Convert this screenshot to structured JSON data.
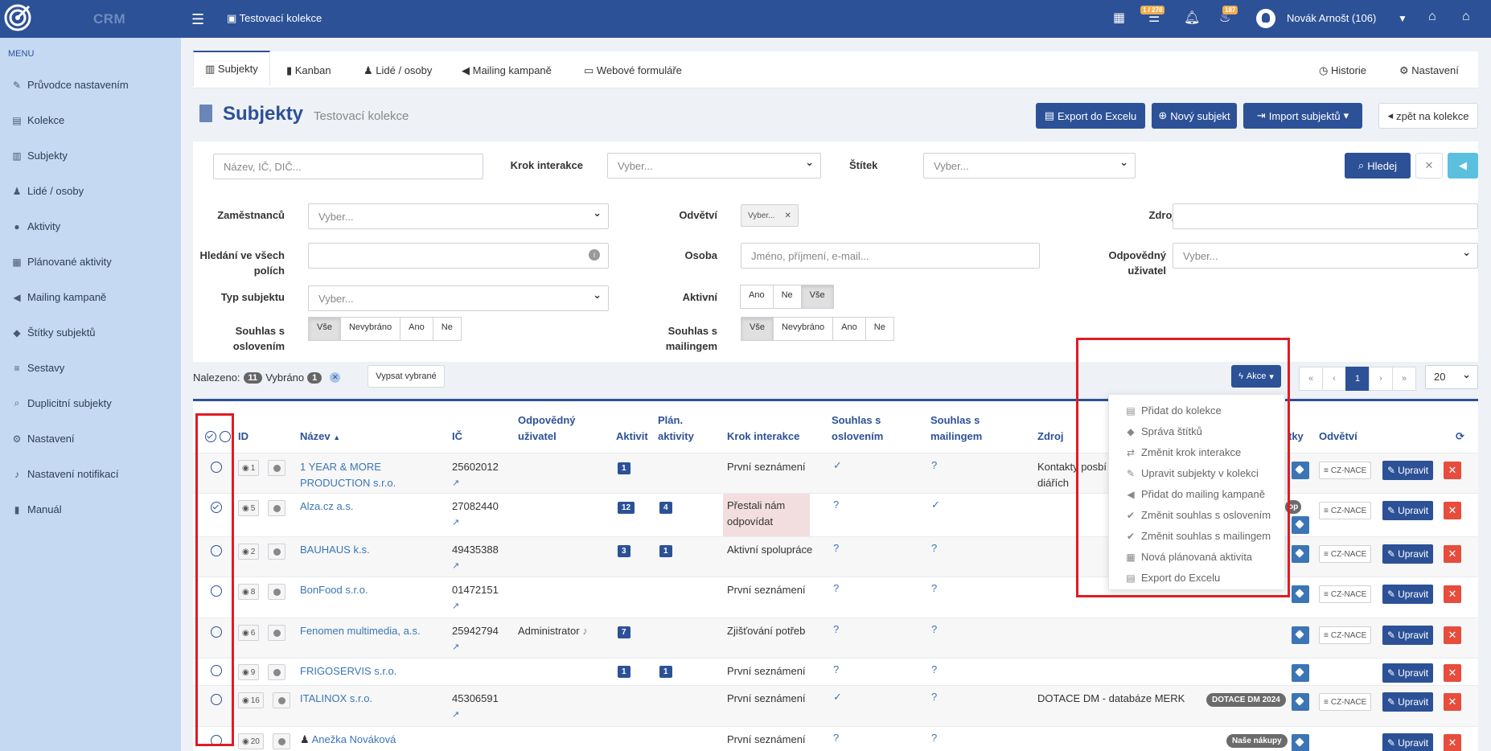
{
  "topbar": {
    "app_name": "CRM",
    "collection": "Testovací kolekce",
    "tasks_badge": "1 / 278",
    "notif_badge": "187",
    "user": "Novák Arnošt (106)"
  },
  "sidebar": {
    "menu_label": "MENU",
    "items": [
      {
        "label": "Průvodce nastavením",
        "icon": "wand-icon"
      },
      {
        "label": "Kolekce",
        "icon": "folders-icon"
      },
      {
        "label": "Subjekty",
        "icon": "building-icon"
      },
      {
        "label": "Lidé / osoby",
        "icon": "person-icon"
      },
      {
        "label": "Aktivity",
        "icon": "comments-icon"
      },
      {
        "label": "Plánované aktivity",
        "icon": "calendar-icon"
      },
      {
        "label": "Mailing kampaně",
        "icon": "megaphone-icon"
      },
      {
        "label": "Štítky subjektů",
        "icon": "tags-icon"
      },
      {
        "label": "Sestavy",
        "icon": "list-icon"
      },
      {
        "label": "Duplicitní subjekty",
        "icon": "search-doc-icon"
      },
      {
        "label": "Nastavení",
        "icon": "gears-icon"
      },
      {
        "label": "Nastavení notifikací",
        "icon": "bell-icon"
      },
      {
        "label": "Manuál",
        "icon": "book-icon"
      }
    ]
  },
  "tabs": {
    "subjekty": "Subjekty",
    "kanban": "Kanban",
    "lide": "Lidé / osoby",
    "mailing": "Mailing kampaně",
    "formulare": "Webové formuláře",
    "historie": "Historie",
    "nastaveni": "Nastavení"
  },
  "header": {
    "title": "Subjekty",
    "subtitle": "Testovací kolekce",
    "export": "Export do Excelu",
    "new": "Nový subjekt",
    "import": "Import subjektů",
    "back": "zpět na kolekce"
  },
  "filters": {
    "search_placeholder": "Název, IČ, DIČ...",
    "krok_label": "Krok interakce",
    "krok_value": "Vyber...",
    "stitek_label": "Štítek",
    "stitek_value": "Vyber...",
    "hledej": "Hledej",
    "zamestnancu_label": "Zaměstnanců",
    "zamestnancu_value": "Vyber...",
    "odvetvi_label": "Odvětví",
    "odvetvi_value": "Vyber...",
    "zdroj_label": "Zdroj",
    "hledani_label": "Hledání ve všech polích",
    "osoba_label": "Osoba",
    "osoba_placeholder": "Jméno, příjmení, e-mail...",
    "odpovedny_label": "Odpovědný uživatel",
    "odpovedny_value": "Vyber...",
    "typ_label": "Typ subjektu",
    "typ_value": "Vyber...",
    "aktivni_label": "Aktivní",
    "aktivni_options": [
      "Ano",
      "Ne",
      "Vše"
    ],
    "souhlas_osl_label": "Souhlas s oslovením",
    "souhlas_mail_label": "Souhlas s mailingem",
    "souhlas_options": [
      "Vše",
      "Nevybráno",
      "Ano",
      "Ne"
    ]
  },
  "results": {
    "nalezeno_label": "Nalezeno:",
    "nalezeno_count": "11",
    "vybrano_label": "Vybráno",
    "vybrano_count": "1",
    "vypsat": "Vypsat vybrané",
    "akce": "Akce",
    "pager": [
      "«",
      "‹",
      "1",
      "›",
      "»"
    ],
    "per_page": "20"
  },
  "table": {
    "headers": {
      "id": "ID",
      "nazev": "Název",
      "ic": "IČ",
      "odpovedny": "Odpovědný uživatel",
      "aktivit": "Aktivit",
      "plan": "Plán. aktivity",
      "krok": "Krok interakce",
      "souhlas_osl": "Souhlas s oslovením",
      "souhlas_mail": "Souhlas s mailingem",
      "zdroj": "Zdroj",
      "stitky": "tky",
      "odvetvi": "Odvětví"
    },
    "rows": [
      {
        "id": "1",
        "nazev": "1 YEAR & MORE PRODUCTION s.r.o.",
        "ic": "25602012",
        "odpovedny": "",
        "aktivit": "1",
        "plan": "",
        "krok": "První seznámení",
        "osl": "✓",
        "mail": "?",
        "zdroj": "Kontakty posbí diářích",
        "badge": "",
        "nace": "CZ-NACE"
      },
      {
        "id": "5",
        "nazev": "Alza.cz a.s.",
        "ic": "27082440",
        "odpovedny": "",
        "aktivit": "12",
        "plan": "4",
        "krok": "Přestali nám odpovídat",
        "osl": "?",
        "mail": "✓",
        "zdroj": "",
        "badge": "op",
        "nace": "CZ-NACE"
      },
      {
        "id": "2",
        "nazev": "BAUHAUS k.s.",
        "ic": "49435388",
        "odpovedny": "",
        "aktivit": "3",
        "plan": "1",
        "krok": "Aktivní spolupráce",
        "osl": "?",
        "mail": "?",
        "zdroj": "",
        "badge": "",
        "nace": "CZ-NACE"
      },
      {
        "id": "8",
        "nazev": "BonFood s.r.o.",
        "ic": "01472151",
        "odpovedny": "",
        "aktivit": "",
        "plan": "",
        "krok": "První seznámení",
        "osl": "?",
        "mail": "?",
        "zdroj": "",
        "badge": "",
        "nace": "CZ-NACE"
      },
      {
        "id": "6",
        "nazev": "Fenomen multimedia, a.s.",
        "ic": "25942794",
        "odpovedny": "Administrator",
        "aktivit": "7",
        "plan": "",
        "krok": "Zjišťování potřeb",
        "osl": "?",
        "mail": "?",
        "zdroj": "",
        "badge": "",
        "nace": "CZ-NACE"
      },
      {
        "id": "9",
        "nazev": "FRIGOSERVIS s.r.o.",
        "ic": "",
        "odpovedny": "",
        "aktivit": "1",
        "plan": "1",
        "krok": "První seznámení",
        "osl": "?",
        "mail": "?",
        "zdroj": "",
        "badge": "",
        "nace": ""
      },
      {
        "id": "16",
        "nazev": "ITALINOX s.r.o.",
        "ic": "45306591",
        "odpovedny": "",
        "aktivit": "",
        "plan": "",
        "krok": "První seznámení",
        "osl": "✓",
        "mail": "?",
        "zdroj": "DOTACE DM - databáze MERK",
        "badge": "DOTACE DM 2024",
        "nace": "CZ-NACE"
      },
      {
        "id": "20",
        "nazev": "Anežka Nováková",
        "ic": "",
        "odpovedny": "",
        "aktivit": "",
        "plan": "",
        "krok": "První seznámení",
        "osl": "?",
        "mail": "?",
        "zdroj": "",
        "badge": "Naše nákupy",
        "nace": ""
      }
    ],
    "upravit": "Upravit"
  },
  "akce_menu": [
    "Přidat do kolekce",
    "Správa štítků",
    "Změnit krok interakce",
    "Upravit subjekty v kolekci",
    "Přidat do mailing kampaně",
    "Změnit souhlas s oslovením",
    "Změnit souhlas s mailingem",
    "Nová plánovaná aktivita",
    "Export do Excelu"
  ],
  "colors": {
    "primary": "#2c5197",
    "sidebar": "#c5d9f3",
    "highlight": "#e01b24",
    "danger": "#e74c3c"
  }
}
